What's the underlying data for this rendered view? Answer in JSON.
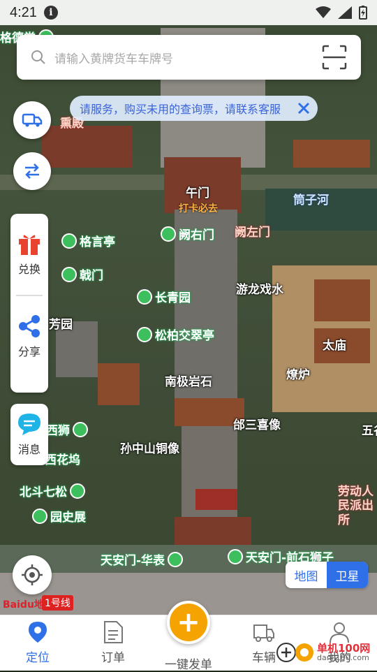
{
  "status": {
    "time": "4:21"
  },
  "search": {
    "placeholder": "请输入黄牌货车车牌号"
  },
  "notice": {
    "text": "请服务，购买未用的查询票，请联系客服"
  },
  "side": {
    "exchange": "兑换",
    "share": "分享",
    "message": "消息"
  },
  "map_toggle": {
    "map": "地图",
    "satellite": "卫星"
  },
  "pois": {
    "wumen": "午门",
    "daka": "打卡必去",
    "geyanting": "格言亭",
    "queyoumen": "阙右门",
    "quezuomen": "阙左门",
    "zaimen": "戟门",
    "changqingyuan": "长青园",
    "youlongxishui": "游龙戏水",
    "fangyuan": "芳园",
    "songbai": "松柏交翠亭",
    "taimiao": "太庙",
    "liaolu": "燎炉",
    "nanji": "南极岩石",
    "bushan": "邰三喜像",
    "sunzhongshan": "孙中山铜像",
    "beidou": "北斗七松",
    "laodong": "劳动人民派出所",
    "tiananmen_hb": "天安门-华表",
    "tiananmen_qs": "天安门-前石狮子",
    "tongzihe": "筒子河",
    "yuanshizhan": "园史展",
    "huahuawu": "西花坞",
    "xishi": "西狮",
    "wuge": "五谷",
    "xunbu": "熏殿",
    "ge": "格德堂"
  },
  "baidu": "Baidu地图",
  "line": "1号线",
  "tabs": {
    "locate": "定位",
    "orders": "订单",
    "publish": "一键发单",
    "vehicle": "车辆",
    "mine": "我的"
  },
  "watermark": {
    "site": "单机100网",
    "url": "danji100.com"
  },
  "colors": {
    "accent": "#2f6fe8",
    "fab": "#f5a300"
  }
}
